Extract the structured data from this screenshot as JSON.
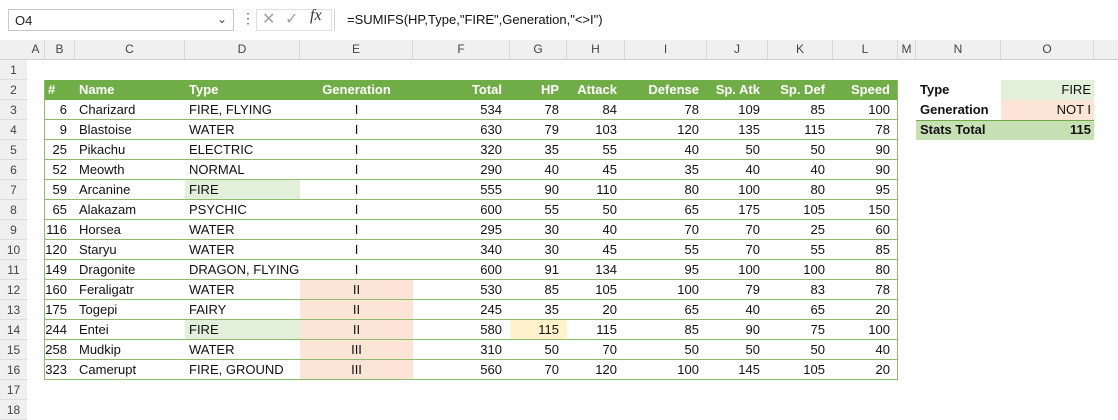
{
  "formula_bar": {
    "name_box": "O4",
    "cancel_icon": "✕",
    "enter_icon": "✓",
    "fx_label": "fx",
    "formula": "=SUMIFS(HP,Type,\"FIRE\",Generation,\"<>I\")"
  },
  "columns": [
    "A",
    "B",
    "C",
    "D",
    "E",
    "F",
    "G",
    "H",
    "I",
    "J",
    "K",
    "L",
    "M",
    "N",
    "O"
  ],
  "rows": [
    "1",
    "2",
    "3",
    "4",
    "5",
    "6",
    "7",
    "8",
    "9",
    "10",
    "11",
    "12",
    "13",
    "14",
    "15",
    "16",
    "17",
    "18"
  ],
  "table": {
    "headers": [
      "#",
      "Name",
      "Type",
      "Generation",
      "Total",
      "HP",
      "Attack",
      "Defense",
      "Sp. Atk",
      "Sp. Def",
      "Speed"
    ],
    "rows": [
      [
        "6",
        "Charizard",
        "FIRE, FLYING",
        "I",
        "534",
        "78",
        "84",
        "78",
        "109",
        "85",
        "100"
      ],
      [
        "9",
        "Blastoise",
        "WATER",
        "I",
        "630",
        "79",
        "103",
        "120",
        "135",
        "115",
        "78"
      ],
      [
        "25",
        "Pikachu",
        "ELECTRIC",
        "I",
        "320",
        "35",
        "55",
        "40",
        "50",
        "50",
        "90"
      ],
      [
        "52",
        "Meowth",
        "NORMAL",
        "I",
        "290",
        "40",
        "45",
        "35",
        "40",
        "40",
        "90"
      ],
      [
        "59",
        "Arcanine",
        "FIRE",
        "I",
        "555",
        "90",
        "110",
        "80",
        "100",
        "80",
        "95"
      ],
      [
        "65",
        "Alakazam",
        "PSYCHIC",
        "I",
        "600",
        "55",
        "50",
        "65",
        "175",
        "105",
        "150"
      ],
      [
        "116",
        "Horsea",
        "WATER",
        "I",
        "295",
        "30",
        "40",
        "70",
        "70",
        "25",
        "60"
      ],
      [
        "120",
        "Staryu",
        "WATER",
        "I",
        "340",
        "30",
        "45",
        "55",
        "70",
        "55",
        "85"
      ],
      [
        "149",
        "Dragonite",
        "DRAGON, FLYING",
        "I",
        "600",
        "91",
        "134",
        "95",
        "100",
        "100",
        "80"
      ],
      [
        "160",
        "Feraligatr",
        "WATER",
        "II",
        "530",
        "85",
        "105",
        "100",
        "79",
        "83",
        "78"
      ],
      [
        "175",
        "Togepi",
        "FAIRY",
        "II",
        "245",
        "35",
        "20",
        "65",
        "40",
        "65",
        "20"
      ],
      [
        "244",
        "Entei",
        "FIRE",
        "II",
        "580",
        "115",
        "115",
        "85",
        "90",
        "75",
        "100"
      ],
      [
        "258",
        "Mudkip",
        "WATER",
        "III",
        "310",
        "50",
        "70",
        "50",
        "50",
        "50",
        "40"
      ],
      [
        "323",
        "Camerupt",
        "FIRE, GROUND",
        "III",
        "560",
        "70",
        "120",
        "100",
        "145",
        "105",
        "20"
      ]
    ]
  },
  "criteria": {
    "type_label": "Type",
    "type_value": "FIRE",
    "generation_label": "Generation",
    "generation_value": "NOT I",
    "total_label": "Stats Total",
    "total_value": "115"
  },
  "colors": {
    "header_green": "#70ad47",
    "highlight_green": "#e2efda",
    "highlight_pink": "#fce4d6",
    "highlight_yellow": "#fff2cc",
    "total_green": "#c6e0b4"
  }
}
